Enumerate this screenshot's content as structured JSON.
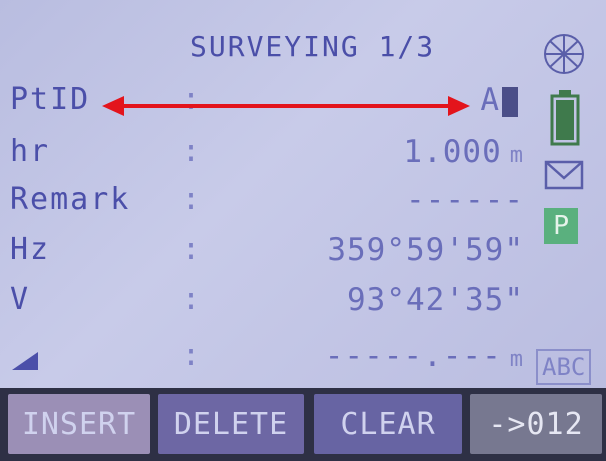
{
  "header": {
    "title": "SURVEYING 1/3"
  },
  "fields": [
    {
      "label": "PtID",
      "value": "A",
      "unit": ""
    },
    {
      "label": "hr",
      "value": "1.000",
      "unit": "m"
    },
    {
      "label": "Remark",
      "value": "------",
      "unit": ""
    },
    {
      "label": "Hz",
      "value": "359°59'59\"",
      "unit": ""
    },
    {
      "label": "V",
      "value": "93°42'35\"",
      "unit": ""
    },
    {
      "label": "",
      "value": "-----.---",
      "unit": "m"
    }
  ],
  "status": {
    "p_label": "P",
    "input_mode": "ABC"
  },
  "softkeys": [
    {
      "label": "INSERT"
    },
    {
      "label": "DELETE"
    },
    {
      "label": "CLEAR"
    },
    {
      "label": "->012"
    }
  ],
  "colors": {
    "screen_bg": "#c2c5e6",
    "text": "#4b4fa9",
    "arrow": "#e3141c",
    "p_icon": "#5ab07e"
  }
}
